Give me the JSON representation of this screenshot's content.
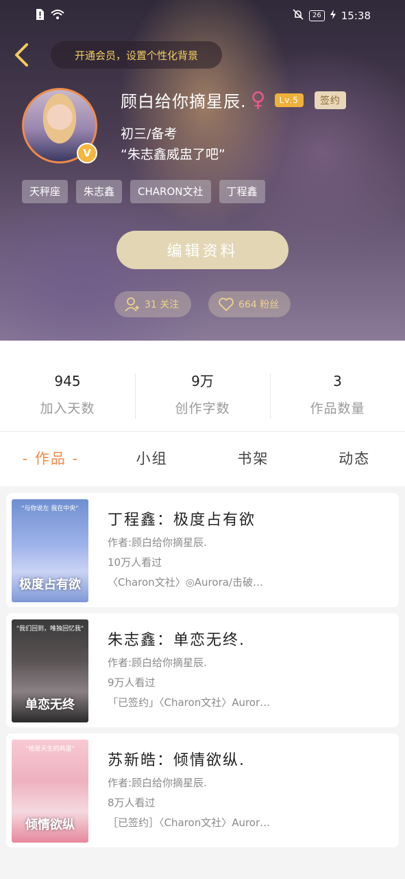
{
  "status_bar": {
    "time": "15:38",
    "battery": "26"
  },
  "header": {
    "vip_banner": "开通会员，设置个性化背景"
  },
  "profile": {
    "username": "顾白给你摘星辰.",
    "gender_symbol": "♀",
    "level": "Lv.5",
    "signed_badge": "签约",
    "grade": "初三/备考",
    "motto": "“朱志鑫威盅了吧”",
    "verified_badge": "V",
    "tags": [
      "天秤座",
      "朱志鑫",
      "CHARON文社",
      "丁程鑫"
    ],
    "edit_button": "编辑资料",
    "following": "31 关注",
    "fans": "664 粉丝"
  },
  "stats": [
    {
      "value": "945",
      "label": "加入天数"
    },
    {
      "value": "9万",
      "label": "创作字数"
    },
    {
      "value": "3",
      "label": "作品数量"
    }
  ],
  "tabs": [
    "- 作品 -",
    "小组",
    "书架",
    "动态"
  ],
  "works": [
    {
      "title": "丁程鑫：极度占有欲",
      "author": "作者:顾白给你摘星辰.",
      "views": "10万人看过",
      "tags": "〈Charon文社〉◎Aurora/击破…",
      "cover_top": "\"与你说左 我在中央\"",
      "cover_text": "极度占有欲"
    },
    {
      "title": "朱志鑫：单恋无终.",
      "author": "作者:顾白给你摘星辰.",
      "views": "9万人看过",
      "tags": "「已签约」〈Charon文社〉Auror…",
      "cover_top": "\"我们回到，唯独回忆我\"",
      "cover_text": "单恋无终"
    },
    {
      "title": "苏新皓：倾情欲纵.",
      "author": "作者:顾白给你摘星辰.",
      "views": "8万人看过",
      "tags": "［已签约］〈Charon文社〉Auror…",
      "cover_top": "\"他是天生的鸡蛋\"",
      "cover_text": "倾情欲纵"
    }
  ],
  "colors": {
    "accent": "#ef8a4a",
    "gold": "#f3cc62",
    "level_badge": "#f0b13b",
    "edit_button": "#e2d6b4"
  }
}
